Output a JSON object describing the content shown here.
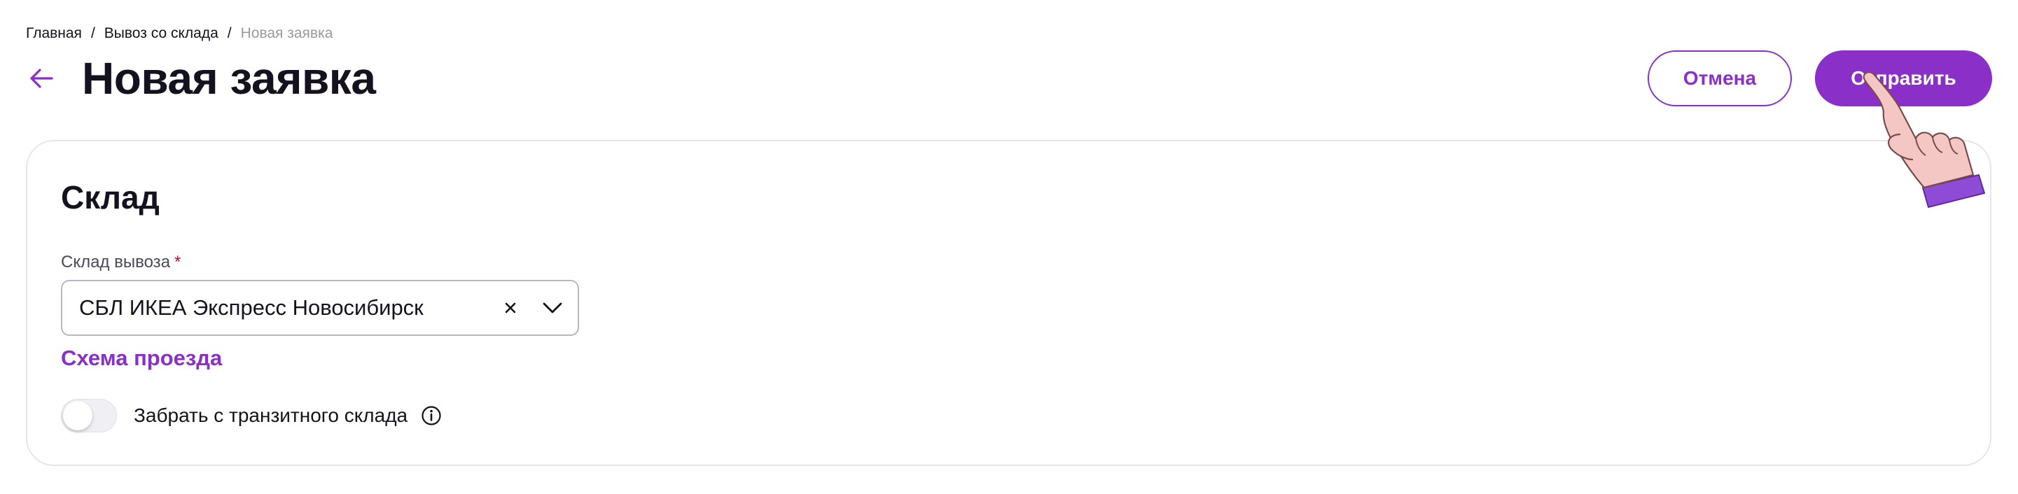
{
  "breadcrumb": {
    "items": [
      "Главная",
      "Вывоз со склада"
    ],
    "current": "Новая заявка",
    "separator": "/"
  },
  "header": {
    "title": "Новая заявка",
    "back_icon": "arrow-left-icon",
    "cancel_label": "Отмена",
    "submit_label": "Отправить"
  },
  "card": {
    "title": "Склад",
    "warehouse_field": {
      "label": "Склад вывоза",
      "required_mark": "*",
      "value": "СБЛ ИКЕА Экспресс Новосибирск",
      "clear_icon": "close-icon",
      "dropdown_icon": "chevron-down-icon"
    },
    "route_link": "Схема проезда",
    "transit_toggle": {
      "label": "Забрать с транзитного склада",
      "checked": false,
      "info_icon": "info-icon"
    }
  },
  "colors": {
    "accent": "#8a2fc8",
    "text": "#15111f",
    "muted": "#9a97a5",
    "required": "#d6003a",
    "border": "#e6e4ec"
  }
}
